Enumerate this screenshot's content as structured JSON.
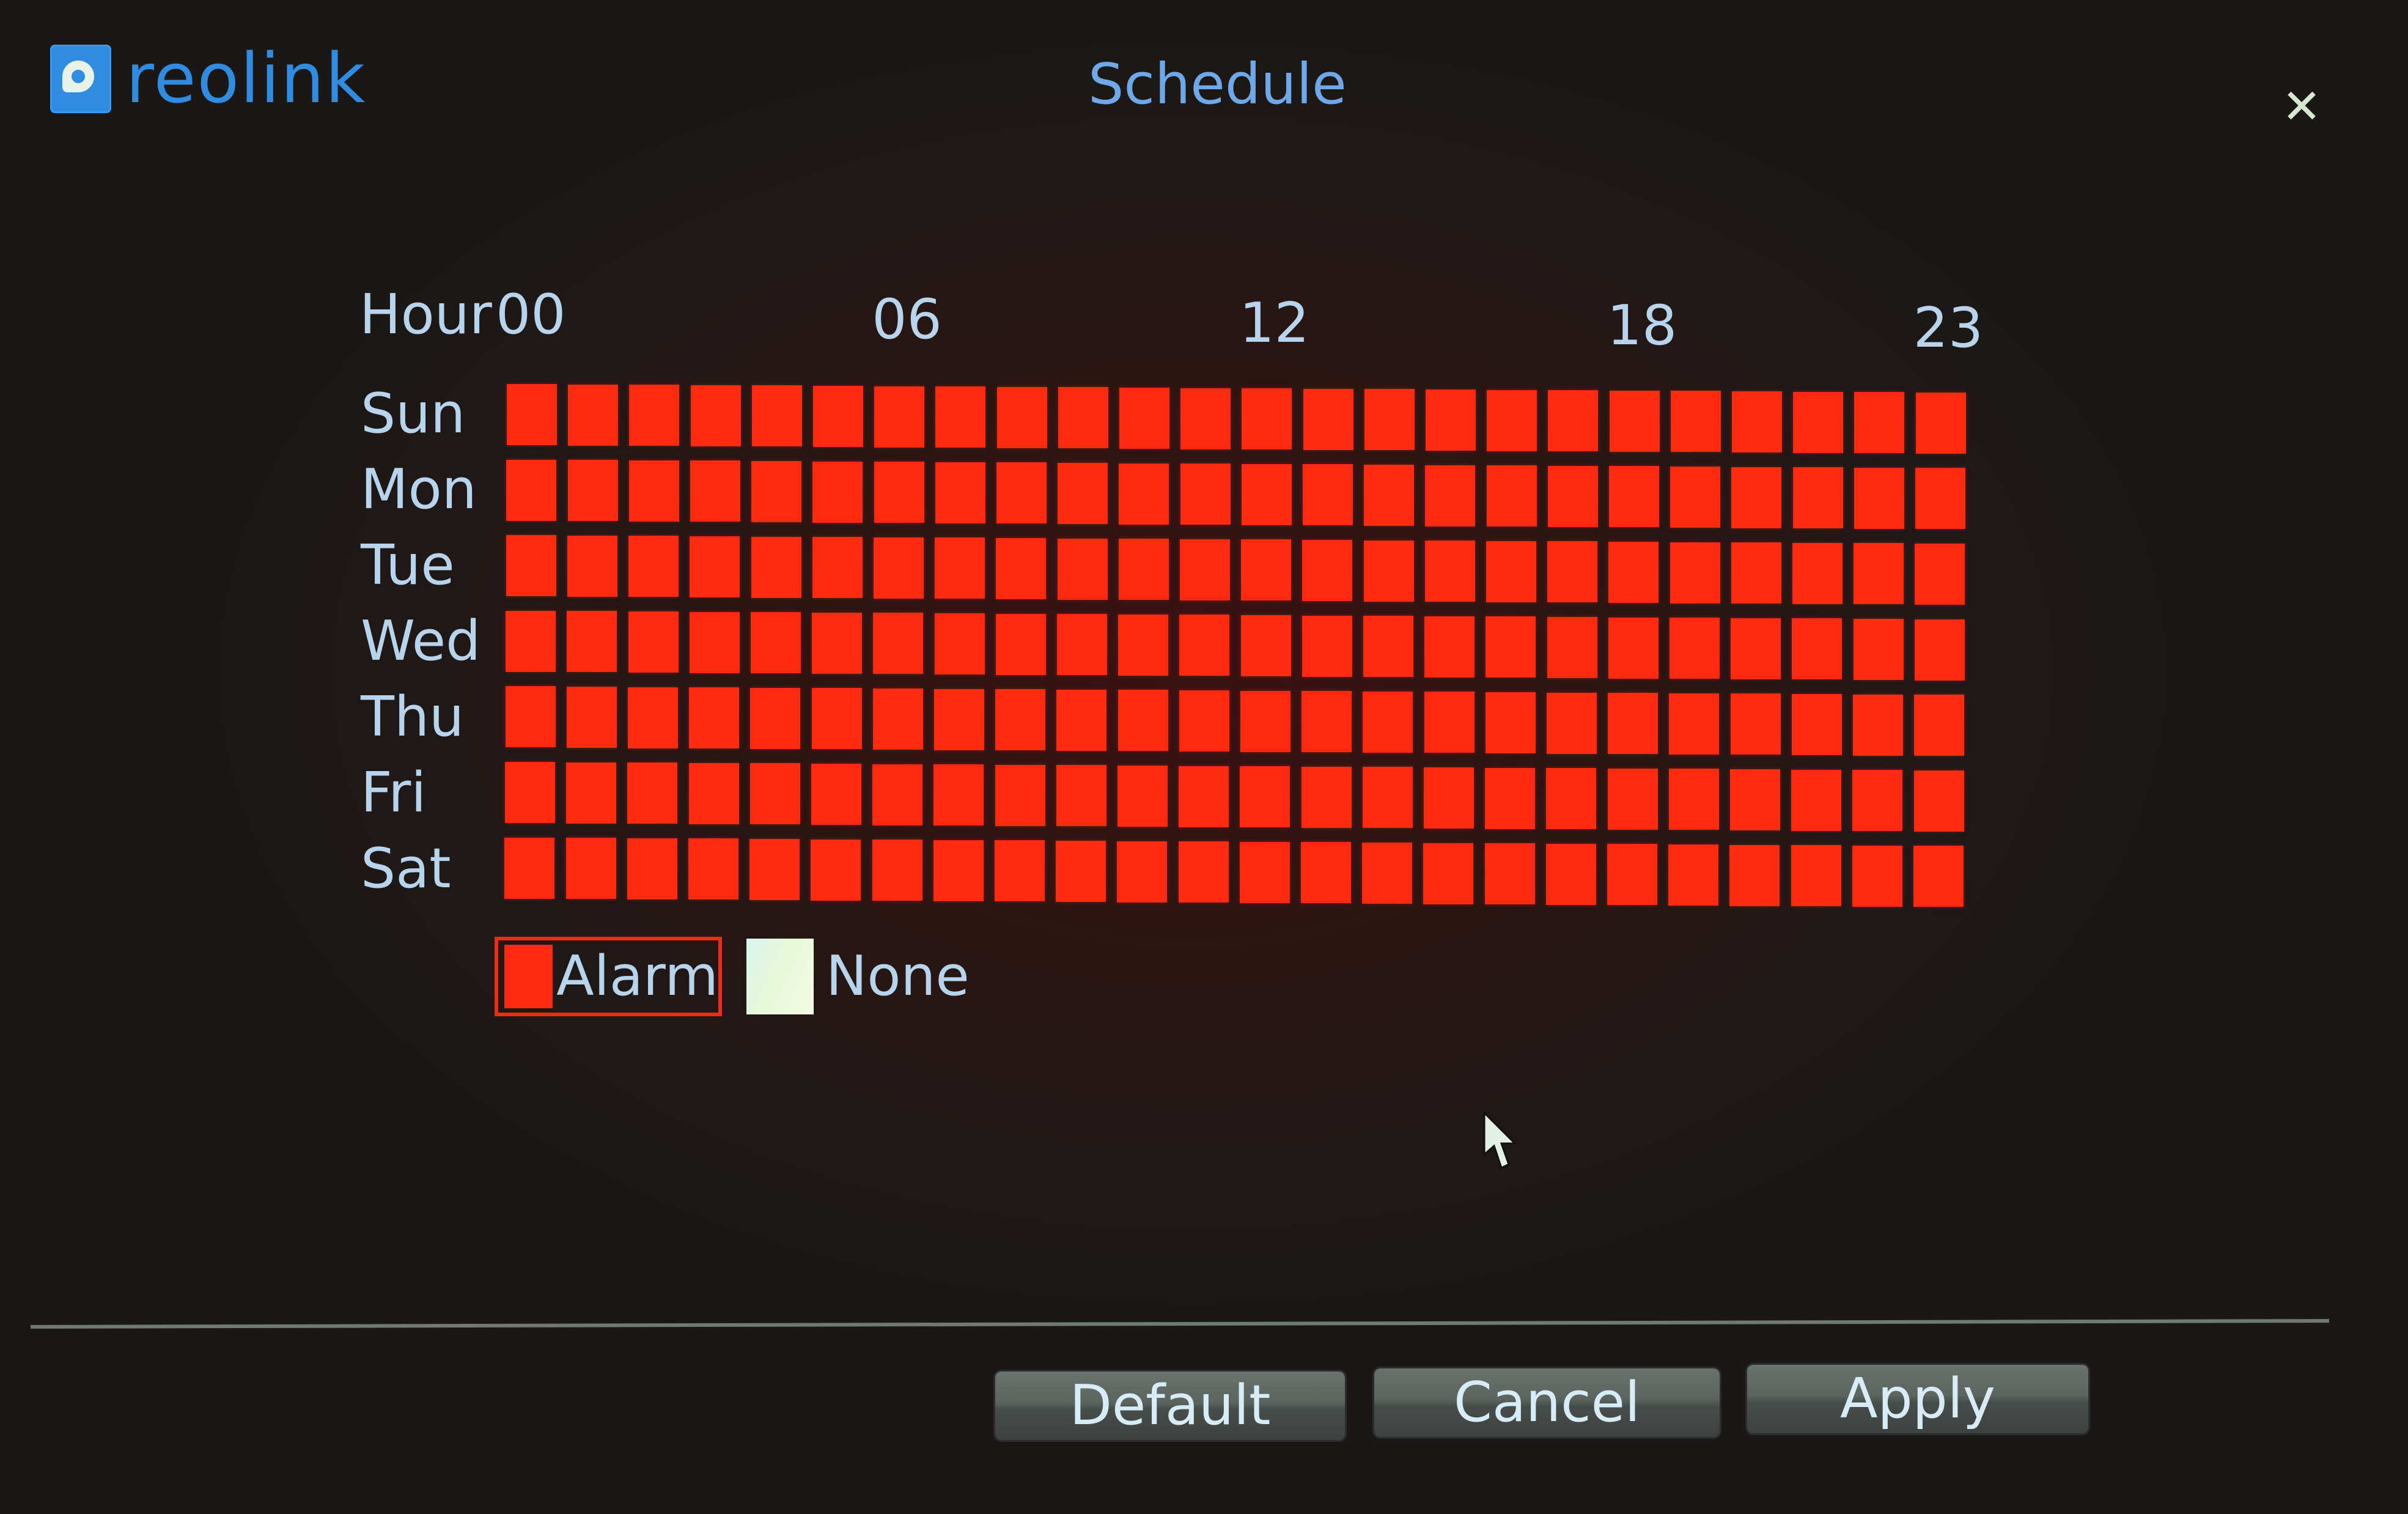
{
  "app": {
    "brand": "reolink",
    "title": "Schedule"
  },
  "icons": {
    "logo": "reolink-logo-icon",
    "close": "close-icon",
    "cursor": "mouse-pointer-icon"
  },
  "schedule": {
    "hour_label": "Hour",
    "hour_ticks": [
      {
        "label": "00",
        "hour": 0
      },
      {
        "label": "06",
        "hour": 6
      },
      {
        "label": "12",
        "hour": 12
      },
      {
        "label": "18",
        "hour": 18
      },
      {
        "label": "23",
        "hour": 23
      }
    ],
    "days": [
      "Sun",
      "Mon",
      "Tue",
      "Wed",
      "Thu",
      "Fri",
      "Sat"
    ],
    "hours_per_day": 24,
    "grid": [
      [
        "alarm",
        "alarm",
        "alarm",
        "alarm",
        "alarm",
        "alarm",
        "alarm",
        "alarm",
        "alarm",
        "alarm",
        "alarm",
        "alarm",
        "alarm",
        "alarm",
        "alarm",
        "alarm",
        "alarm",
        "alarm",
        "alarm",
        "alarm",
        "alarm",
        "alarm",
        "alarm",
        "alarm"
      ],
      [
        "alarm",
        "alarm",
        "alarm",
        "alarm",
        "alarm",
        "alarm",
        "alarm",
        "alarm",
        "alarm",
        "alarm",
        "alarm",
        "alarm",
        "alarm",
        "alarm",
        "alarm",
        "alarm",
        "alarm",
        "alarm",
        "alarm",
        "alarm",
        "alarm",
        "alarm",
        "alarm",
        "alarm"
      ],
      [
        "alarm",
        "alarm",
        "alarm",
        "alarm",
        "alarm",
        "alarm",
        "alarm",
        "alarm",
        "alarm",
        "alarm",
        "alarm",
        "alarm",
        "alarm",
        "alarm",
        "alarm",
        "alarm",
        "alarm",
        "alarm",
        "alarm",
        "alarm",
        "alarm",
        "alarm",
        "alarm",
        "alarm"
      ],
      [
        "alarm",
        "alarm",
        "alarm",
        "alarm",
        "alarm",
        "alarm",
        "alarm",
        "alarm",
        "alarm",
        "alarm",
        "alarm",
        "alarm",
        "alarm",
        "alarm",
        "alarm",
        "alarm",
        "alarm",
        "alarm",
        "alarm",
        "alarm",
        "alarm",
        "alarm",
        "alarm",
        "alarm"
      ],
      [
        "alarm",
        "alarm",
        "alarm",
        "alarm",
        "alarm",
        "alarm",
        "alarm",
        "alarm",
        "alarm",
        "alarm",
        "alarm",
        "alarm",
        "alarm",
        "alarm",
        "alarm",
        "alarm",
        "alarm",
        "alarm",
        "alarm",
        "alarm",
        "alarm",
        "alarm",
        "alarm",
        "alarm"
      ],
      [
        "alarm",
        "alarm",
        "alarm",
        "alarm",
        "alarm",
        "alarm",
        "alarm",
        "alarm",
        "alarm",
        "alarm",
        "alarm",
        "alarm",
        "alarm",
        "alarm",
        "alarm",
        "alarm",
        "alarm",
        "alarm",
        "alarm",
        "alarm",
        "alarm",
        "alarm",
        "alarm",
        "alarm"
      ],
      [
        "alarm",
        "alarm",
        "alarm",
        "alarm",
        "alarm",
        "alarm",
        "alarm",
        "alarm",
        "alarm",
        "alarm",
        "alarm",
        "alarm",
        "alarm",
        "alarm",
        "alarm",
        "alarm",
        "alarm",
        "alarm",
        "alarm",
        "alarm",
        "alarm",
        "alarm",
        "alarm",
        "alarm"
      ]
    ]
  },
  "legend": {
    "alarm_label": "Alarm",
    "none_label": "None",
    "selected": "alarm",
    "colors": {
      "alarm": "#ff2a10",
      "none": "#f2f7e4"
    }
  },
  "buttons": {
    "default_label": "Default",
    "cancel_label": "Cancel",
    "apply_label": "Apply"
  },
  "colors": {
    "accent": "#2f8ce0",
    "text": "#b8d4ec",
    "alarm": "#ff2a10"
  }
}
